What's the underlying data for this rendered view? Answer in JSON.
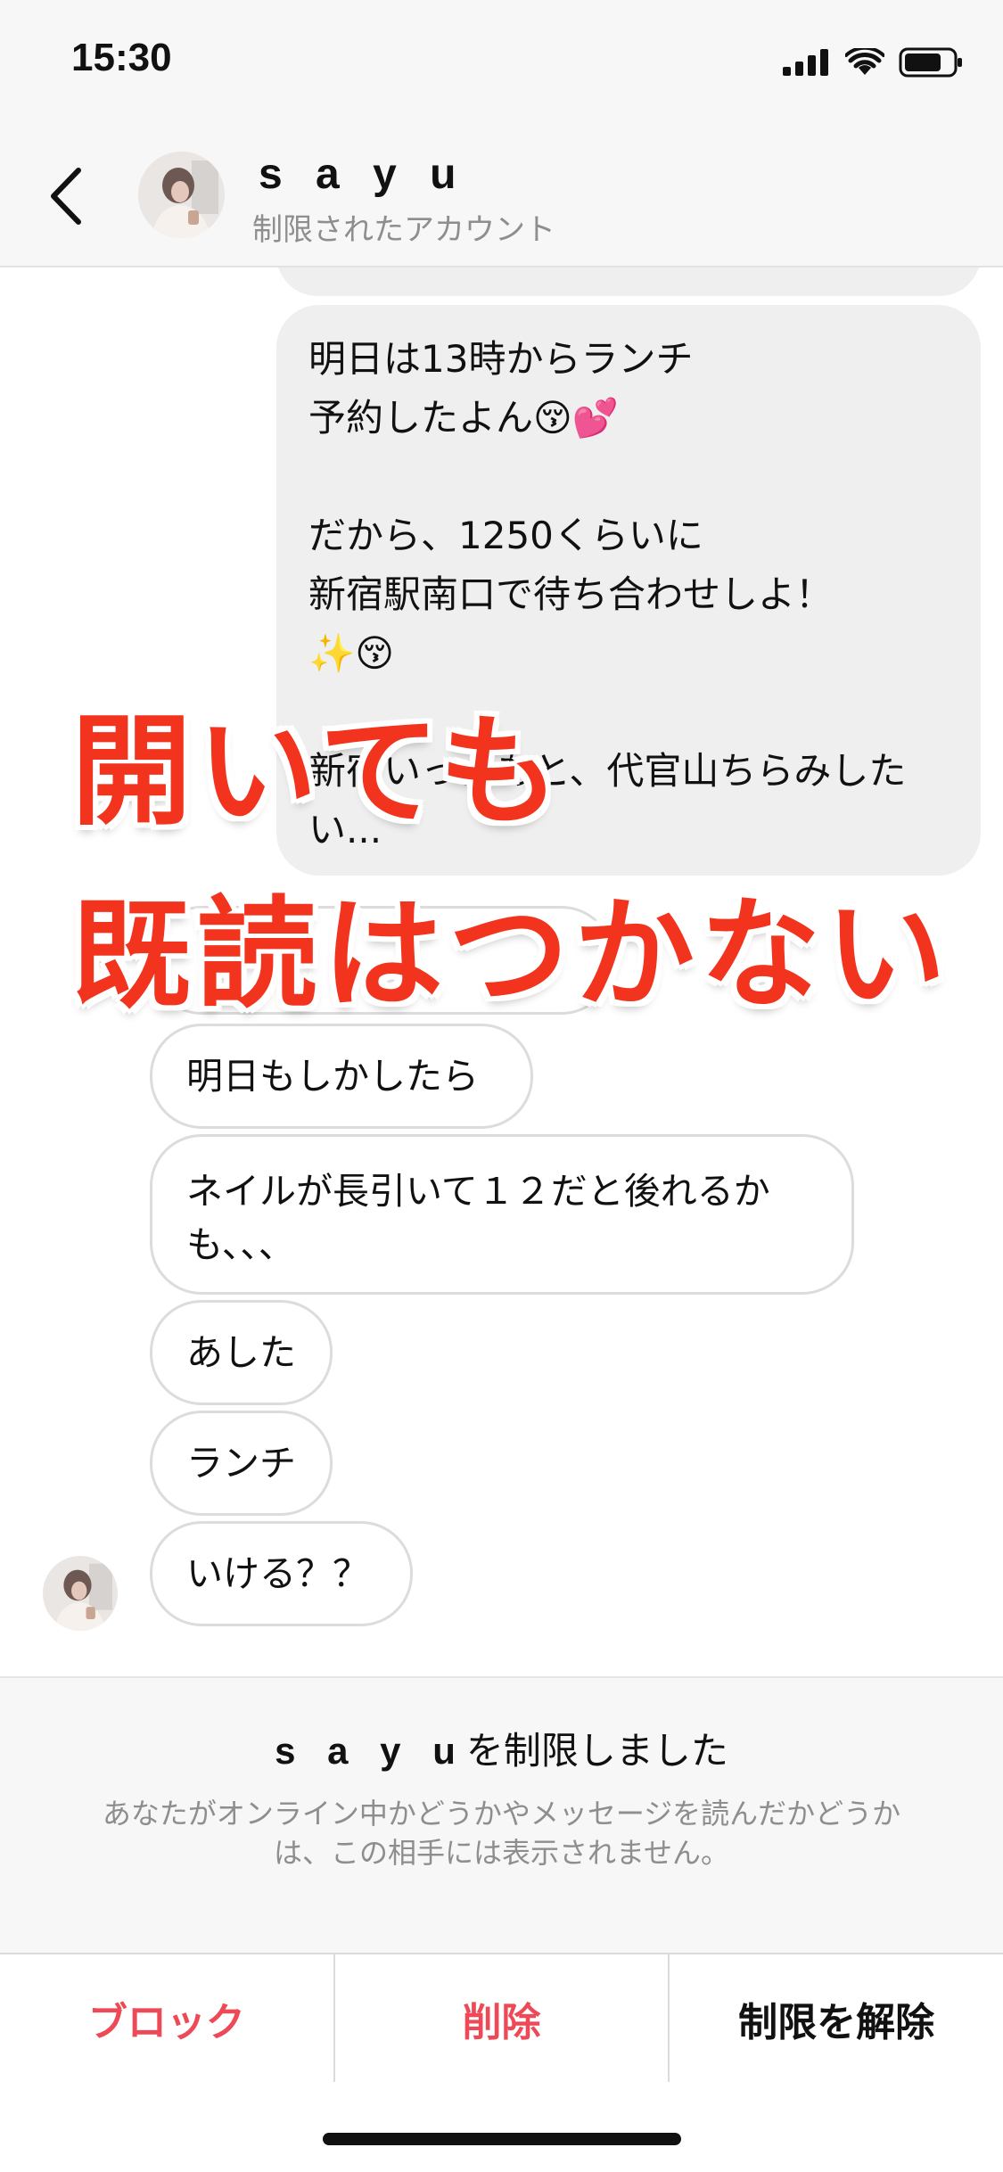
{
  "status_bar": {
    "time": "15:30"
  },
  "header": {
    "name": "s a y u",
    "subtitle": "制限されたアカウント"
  },
  "messages_out": {
    "main": "明日は13時からランチ\n予約したよん😚💕\n\nだから、1250くらいに\n新宿駅南口で待ち合わせしよ！\n✨😚\n\n新宿いったあと、代官山ちらみした\nい..."
  },
  "messages_in": [
    {
      "text": "明日もしかしたら"
    },
    {
      "text": "ネイルが長引いて１２だと後れるかも、、、"
    },
    {
      "text": "あした"
    },
    {
      "text": "ランチ"
    },
    {
      "text": "いける？？"
    }
  ],
  "caption": {
    "line1": "開いても",
    "line2": "既読はつかない"
  },
  "notice": {
    "name": "s a y u",
    "title_suffix": "を制限しました",
    "description": "あなたがオンライン中かどうかやメッセージを読んだかどうかは、この相手には表示されません。"
  },
  "actions": {
    "block": "ブロック",
    "delete": "削除",
    "unrestrict": "制限を解除"
  },
  "colors": {
    "caption": "#f2331d",
    "action_red": "#ed4956"
  }
}
